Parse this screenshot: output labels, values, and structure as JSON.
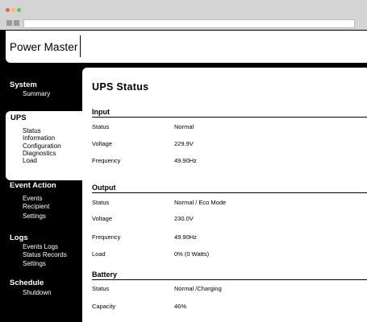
{
  "app": {
    "title": "Power Master"
  },
  "sidebar": {
    "groups": [
      {
        "title": "System",
        "items": [
          "Summary"
        ]
      },
      {
        "title": "UPS",
        "items": [
          "Status",
          "Information",
          "Configuration",
          "Diagnostics",
          "Load"
        ]
      },
      {
        "title": "Event Action",
        "items": [
          "Events",
          "Recipient",
          "Settings"
        ]
      },
      {
        "title": "Logs",
        "items": [
          "Events Logs",
          "Status Records",
          "Settings"
        ]
      },
      {
        "title": "Schedule",
        "items": [
          "Shutdown"
        ]
      }
    ]
  },
  "main": {
    "title": "UPS  Status",
    "sections": [
      {
        "title": "Input",
        "rows": [
          {
            "label": "Status",
            "value": "Normal"
          },
          {
            "label": "Voltage",
            "value": "229.9V"
          },
          {
            "label": "Frequency",
            "value": "49.90Hz"
          }
        ]
      },
      {
        "title": "Output",
        "rows": [
          {
            "label": "Status",
            "value": "Normal / Eco Mode"
          },
          {
            "label": "Voltage",
            "value": "230.0V"
          },
          {
            "label": "Frequency",
            "value": "49.90Hz"
          },
          {
            "label": "Load",
            "value": "0% (0 Watts)"
          }
        ]
      },
      {
        "title": "Battery",
        "rows": [
          {
            "label": "Status",
            "value": "Normal /Charging"
          },
          {
            "label": "Capacity",
            "value": "46%"
          }
        ]
      }
    ]
  }
}
